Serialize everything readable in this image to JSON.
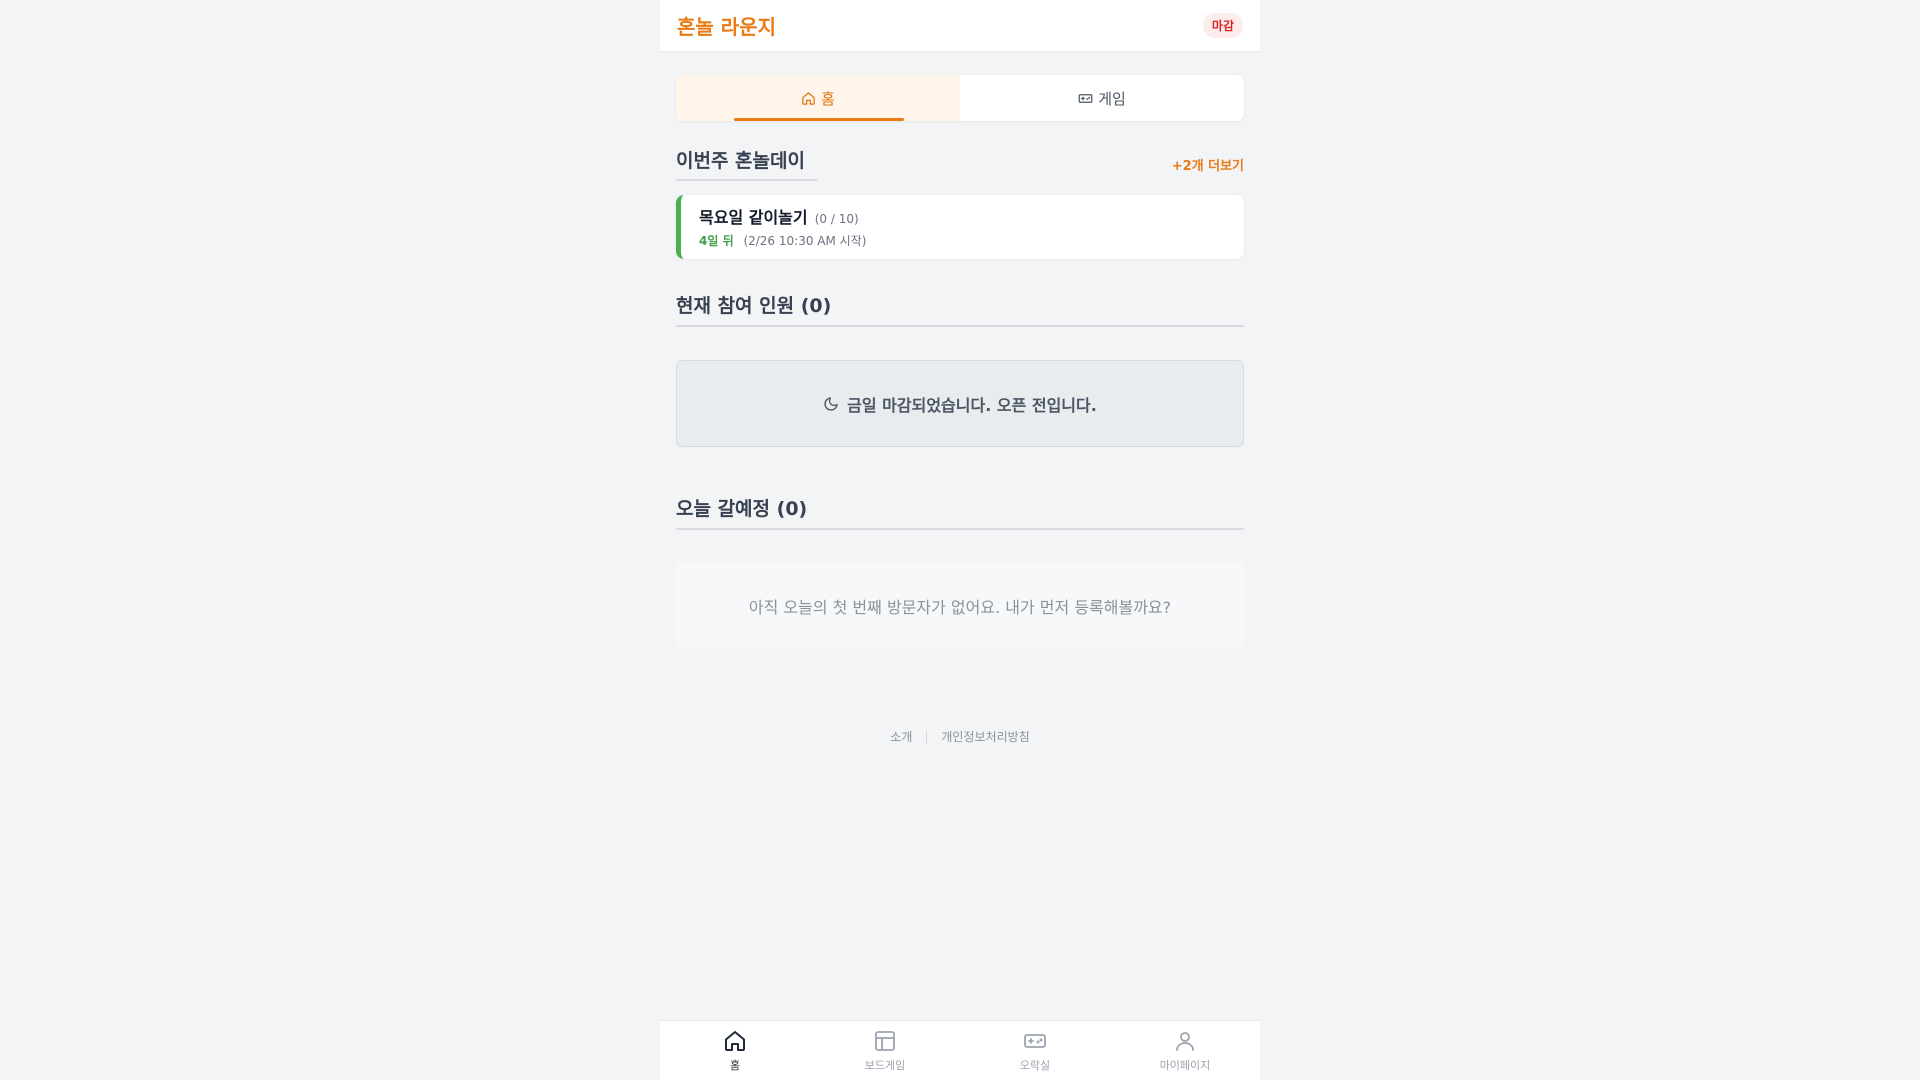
{
  "header": {
    "title": "혼놀 라운지",
    "status_badge": "마감"
  },
  "tabs": [
    {
      "label": "홈",
      "icon": "home-icon",
      "active": true
    },
    {
      "label": "게임",
      "icon": "gamepad-icon",
      "active": false
    }
  ],
  "weekly": {
    "title": "이번주 혼놀데이",
    "more_label": "+2개 더보기",
    "event": {
      "title": "목요일 같이놀기",
      "count": "(0 / 10)",
      "dday": "4일 뒤",
      "date": "(2/26 10:30 AM 시작)"
    }
  },
  "participants": {
    "title": "현재 참여 인원 (0)",
    "closed_message": "금일 마감되었습니다. 오픈 전입니다.",
    "closed_icon": "moon-icon"
  },
  "visitors": {
    "title": "오늘 갈예정 (0)",
    "empty_message": "아직 오늘의 첫 번째 방문자가 없어요. 내가 먼저 등록해볼까요?"
  },
  "footer": {
    "about": "소개",
    "privacy": "개인정보처리방침"
  },
  "bottom_nav": [
    {
      "label": "홈",
      "icon": "home-icon",
      "active": true
    },
    {
      "label": "보드게임",
      "icon": "board-icon",
      "active": false
    },
    {
      "label": "오락실",
      "icon": "gamepad-icon",
      "active": false
    },
    {
      "label": "마이페이지",
      "icon": "user-icon",
      "active": false
    }
  ],
  "colors": {
    "accent": "#ea7a14",
    "event_bar": "#4caf50",
    "badge_text": "#dc2626"
  }
}
